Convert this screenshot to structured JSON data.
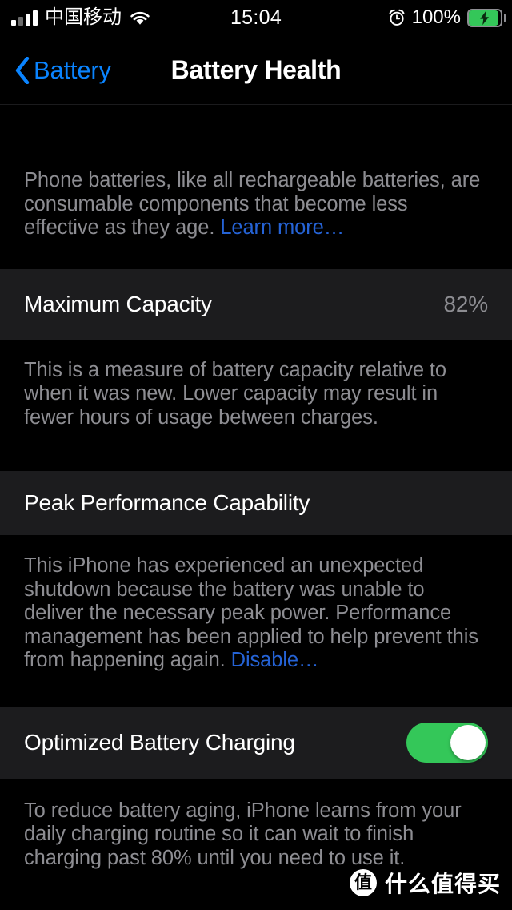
{
  "status_bar": {
    "carrier": "中国移动",
    "time": "15:04",
    "battery_percent": "100%",
    "signal_icon": "cellular-signal-bars-icon",
    "wifi_icon": "wifi-icon",
    "alarm_icon": "alarm-clock-icon",
    "battery_icon": "battery-charging-icon",
    "battery_color": "#34c759"
  },
  "nav_bar": {
    "back_label": "Battery",
    "back_icon": "chevron-left-icon",
    "title": "Battery Health",
    "accent_color": "#0a84ff"
  },
  "sections": {
    "header_footer": {
      "text": "Phone batteries, like all rechargeable batteries, are consumable components that become less effective as they age. ",
      "link_label": "Learn more…"
    },
    "maximum_capacity": {
      "title": "Maximum Capacity",
      "value": "82%",
      "footer": "This is a measure of battery capacity relative to when it was new. Lower capacity may result in fewer hours of usage between charges."
    },
    "peak_performance": {
      "title": "Peak Performance Capability",
      "footer_text": "This iPhone has experienced an unexpected shutdown because the battery was unable to deliver the necessary peak power. Performance management has been applied to help prevent this from happening again. ",
      "footer_link": "Disable…"
    },
    "optimized_charging": {
      "title": "Optimized Battery Charging",
      "toggle_state": "on",
      "toggle_color": "#34c759",
      "footer": "To reduce battery aging, iPhone learns from your daily charging routine so it can wait to finish charging past 80% until you need to use it."
    }
  },
  "watermark": {
    "badge_char": "值",
    "text": "什么值得买"
  }
}
